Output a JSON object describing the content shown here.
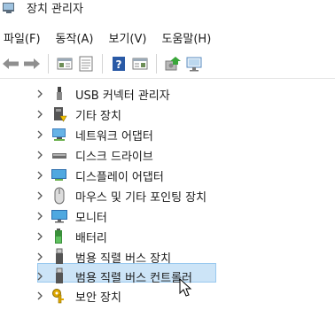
{
  "window": {
    "title": "장치 관리자"
  },
  "menu": [
    "파일(F)",
    "동작(A)",
    "보기(V)",
    "도움말(H)"
  ],
  "toolbar": [
    "back-icon",
    "forward-icon",
    "properties-pane-icon",
    "view-icon",
    "help-icon",
    "action-pane-icon",
    "update-driver-icon",
    "scan-hardware-icon"
  ],
  "tree": [
    {
      "label": "USB 커넥터 관리자",
      "icon": "usb-connector-icon"
    },
    {
      "label": "기타 장치",
      "icon": "other-devices-icon"
    },
    {
      "label": "네트워크 어댑터",
      "icon": "network-adapter-icon"
    },
    {
      "label": "디스크 드라이브",
      "icon": "disk-drive-icon"
    },
    {
      "label": "디스플레이 어댑터",
      "icon": "display-adapter-icon"
    },
    {
      "label": "마우스 및 기타 포인팅 장치",
      "icon": "mouse-icon"
    },
    {
      "label": "모니터",
      "icon": "monitor-icon"
    },
    {
      "label": "배터리",
      "icon": "battery-icon"
    },
    {
      "label": "범용 직렬 버스 장치",
      "icon": "usb-device-icon"
    },
    {
      "label": "범용 직렬 버스 컨트롤러",
      "icon": "usb-controller-icon"
    },
    {
      "label": "보안 장치",
      "icon": "security-device-icon"
    }
  ],
  "selected_index": 9,
  "colors": {
    "selection_bg": "#cce4f7",
    "selection_border": "#99c9ef"
  }
}
